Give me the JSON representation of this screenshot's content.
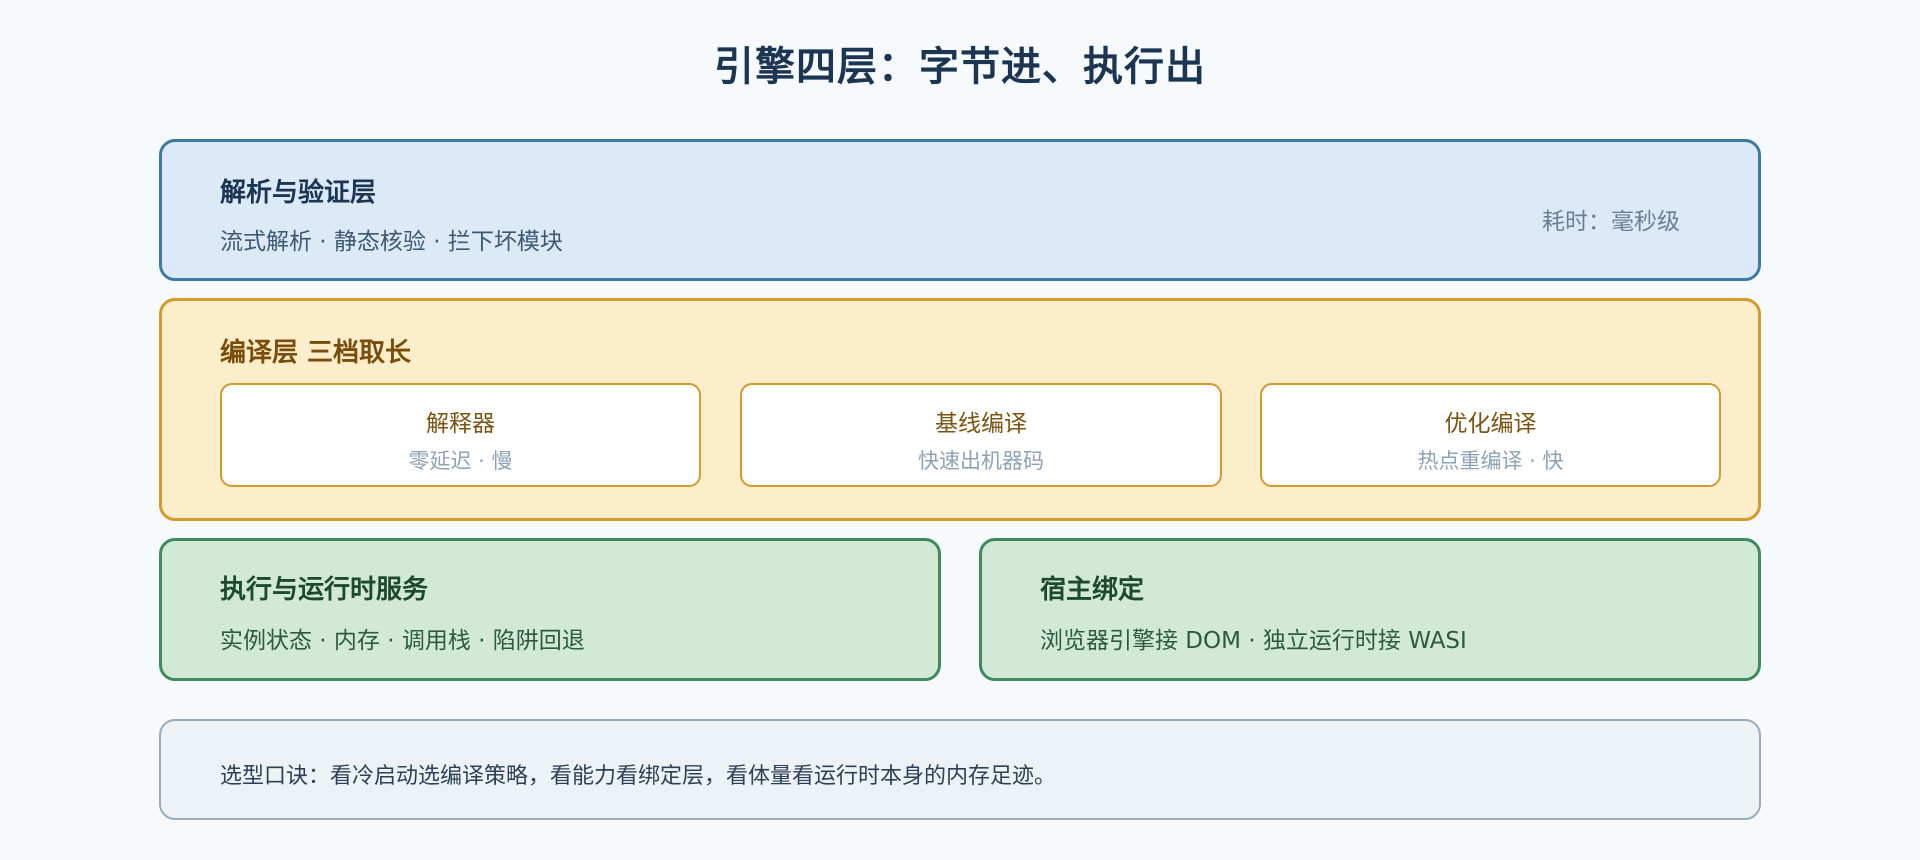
{
  "title": "引擎四层：字节进、执行出",
  "layers": {
    "parse": {
      "title": "解析与验证层",
      "desc": "流式解析 · 静态核验 · 拦下坏模块",
      "note": "耗时：毫秒级"
    },
    "compile": {
      "title": "编译层 三档取长",
      "tiers": [
        {
          "name": "解释器",
          "desc": "零延迟 · 慢"
        },
        {
          "name": "基线编译",
          "desc": "快速出机器码"
        },
        {
          "name": "优化编译",
          "desc": "热点重编译 · 快"
        }
      ]
    },
    "exec": {
      "title": "执行与运行时服务",
      "desc": "实例状态 · 内存 · 调用栈 · 陷阱回退"
    },
    "host": {
      "title": "宿主绑定",
      "desc": "浏览器引擎接 DOM · 独立运行时接 WASI"
    }
  },
  "tip": "选型口诀：看冷启动选编译策略，看能力看绑定层，看体量看运行时本身的内存足迹。",
  "colors": {
    "parse_fill": "#dceaf7",
    "parse_border": "#3f7aa3",
    "compile_fill": "#fdeecb",
    "compile_border": "#d39a2f",
    "runtime_fill": "#d2e9d8",
    "runtime_border": "#3f8b5e",
    "tip_fill": "#edf2f7"
  }
}
